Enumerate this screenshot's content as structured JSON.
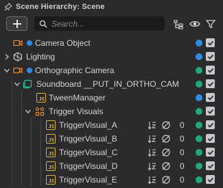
{
  "panel": {
    "title": "Scene Hierarchy: Scene"
  },
  "toolbar": {
    "add_label": "+",
    "search_placeholder": "Search..."
  },
  "colors": {
    "camera_icon": "#e8862e",
    "status_blue": "#2e8fe8",
    "status_green": "#1fa87a",
    "js_badge": "#e0b33a",
    "background": "#2b2b2d"
  },
  "tree": {
    "camera_object": {
      "label": "Camera Object",
      "status": "blue",
      "icon": "camera-icon"
    },
    "lighting": {
      "label": "Lighting",
      "status": "blue",
      "icon": "lighting-icon"
    },
    "ortho_camera": {
      "label": "Orthographic Camera",
      "status": "green",
      "icon": "camera-icon"
    },
    "soundboard": {
      "label": "Soundboard __PUT_IN_ORTHO_CAM",
      "status": "green",
      "icon": "screen-transform-icon"
    },
    "tween_manager": {
      "label": "TweenManager",
      "status": "blue",
      "icon": "js-script-icon"
    },
    "trigger_visuals": {
      "label": "Trigger Visuals",
      "status": "green",
      "icon": "group-icon"
    },
    "visuals": [
      {
        "label": "TriggerVisual_A",
        "count": "0"
      },
      {
        "label": "TriggerVisual_B",
        "count": "0"
      },
      {
        "label": "TriggerVisual_C",
        "count": "0"
      },
      {
        "label": "TriggerVisual_D",
        "count": "0"
      },
      {
        "label": "TriggerVisual_E",
        "count": "0"
      }
    ],
    "js_badge_text": "JS"
  }
}
